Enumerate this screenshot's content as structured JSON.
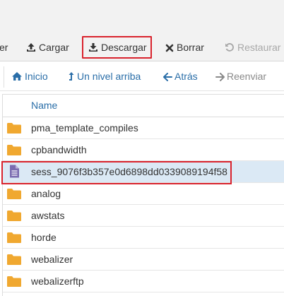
{
  "toolbar": {
    "partial_label": "er",
    "upload_label": "Cargar",
    "download_label": "Descargar",
    "delete_label": "Borrar",
    "restore_label": "Restaurar"
  },
  "nav": {
    "home_label": "Inicio",
    "up_label": "Un nivel arriba",
    "back_label": "Atrás",
    "forward_label": "Reenviar"
  },
  "table": {
    "column_name": "Name",
    "rows": [
      {
        "name": "pma_template_compiles",
        "type": "folder"
      },
      {
        "name": "cpbandwidth",
        "type": "folder"
      },
      {
        "name": "sess_9076f3b357e0d6898dd0339089194f58",
        "type": "file",
        "selected": true
      },
      {
        "name": "analog",
        "type": "folder"
      },
      {
        "name": "awstats",
        "type": "folder"
      },
      {
        "name": "horde",
        "type": "folder"
      },
      {
        "name": "webalizer",
        "type": "folder"
      },
      {
        "name": "webalizerftp",
        "type": "folder"
      }
    ]
  },
  "colors": {
    "link": "#2a6ea8",
    "folder": "#f0a830",
    "file": "#7a6bb0",
    "highlight": "#d9232d",
    "selected_row": "#dbe9f5"
  }
}
